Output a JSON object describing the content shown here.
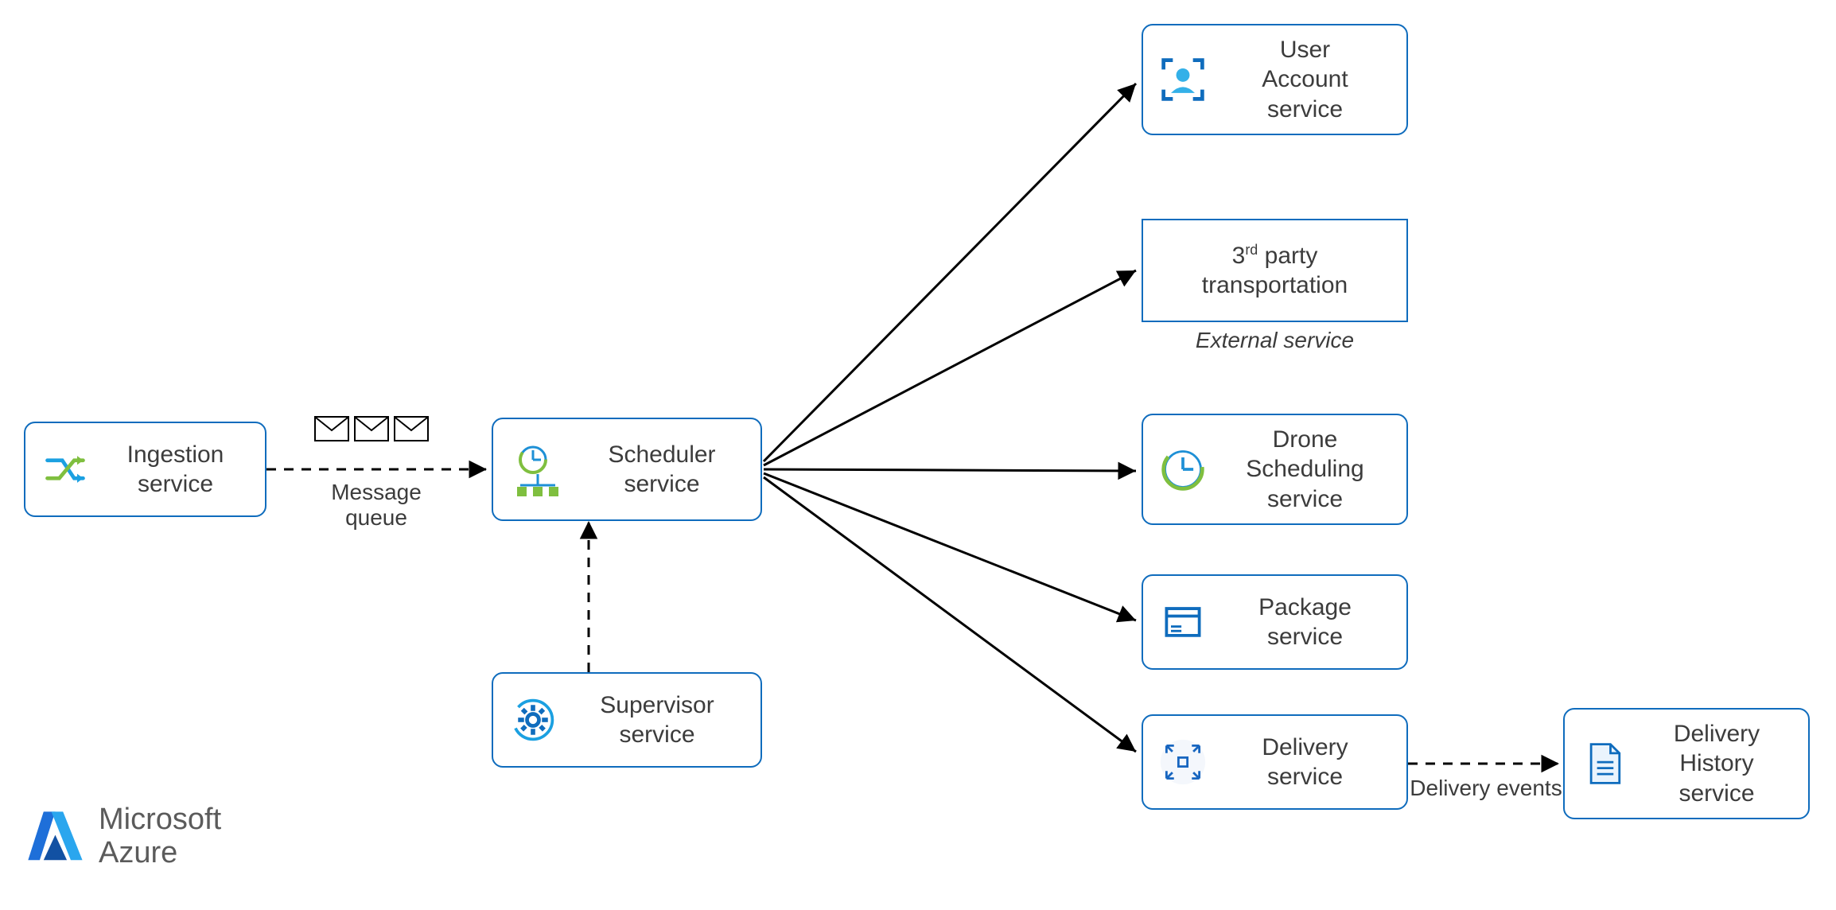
{
  "nodes": {
    "ingestion": {
      "label": "Ingestion\nservice"
    },
    "scheduler": {
      "label": "Scheduler\nservice"
    },
    "supervisor": {
      "label": "Supervisor\nservice"
    },
    "user_account": {
      "label": "User\nAccount\nservice"
    },
    "third_party": {
      "label": "3rd party\ntransportation"
    },
    "drone": {
      "label": "Drone\nScheduling\nservice"
    },
    "package": {
      "label": "Package\nservice"
    },
    "delivery": {
      "label": "Delivery\nservice"
    },
    "history": {
      "label": "Delivery\nHistory\nservice"
    }
  },
  "captions": {
    "message_queue": "Message\nqueue",
    "external_service": "External service",
    "delivery_events": "Delivery events"
  },
  "branding": {
    "line1": "Microsoft",
    "line2": "Azure"
  }
}
